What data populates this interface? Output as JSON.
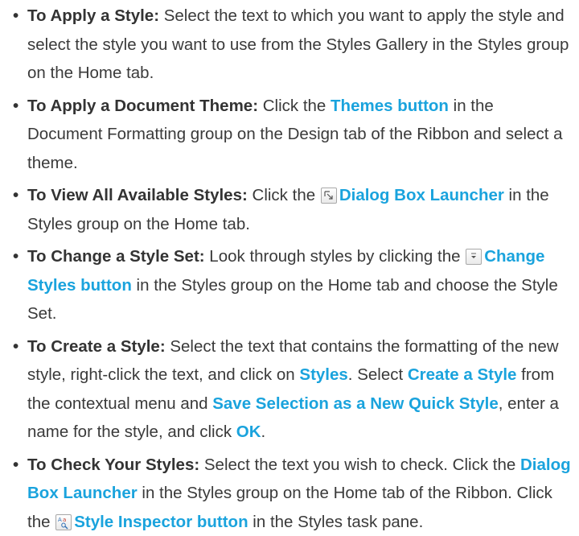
{
  "bullet": "•",
  "items": [
    {
      "lead": "To Apply a Style:",
      "p1": " Select the text to which you want to apply the style and select the style you want to use from the Styles Gallery in the Styles group on the Home tab."
    },
    {
      "lead": "To Apply a Document Theme:",
      "p1": " Click the ",
      "h1": "Themes button",
      "p2": " in the Document Formatting group on the Design tab of the Ribbon and select a theme."
    },
    {
      "lead": "To View All Available Styles:",
      "p1": " Click the ",
      "icon": "dialog-box-launcher-icon",
      "h1": "Dialog Box Launcher",
      "p2": " in the Styles group on the Home tab."
    },
    {
      "lead": "To Change a Style Set:",
      "p1": " Look through styles by clicking the ",
      "icon": "dropdown-arrow-icon",
      "h1": "Change Styles button",
      "p2": " in the Styles group on the Home tab and choose the Style Set."
    },
    {
      "lead": "To Create a Style:",
      "p1": " Select the text that contains the formatting of the new style, right-click the text, and click on ",
      "h1": "Styles",
      "p2": ". Select ",
      "h2": "Create a Style",
      "p3": " from the contextual menu and ",
      "h3": "Save Selection as a New Quick Style",
      "p4": ", enter a name for the style, and click ",
      "h4": "OK",
      "p5": "."
    },
    {
      "lead": "To Check Your Styles:",
      "p1": " Select the text you wish to check. Click the ",
      "h1": "Dialog Box Launcher",
      "p2": " in the Styles group on the Home tab of the Ribbon. Click the ",
      "icon": "style-inspector-icon",
      "h2": "Style Inspector button",
      "p3": " in the Styles task pane."
    }
  ],
  "colors": {
    "text": "#3a3a3a",
    "heading": "#333333",
    "accent": "#1aa3dd"
  }
}
